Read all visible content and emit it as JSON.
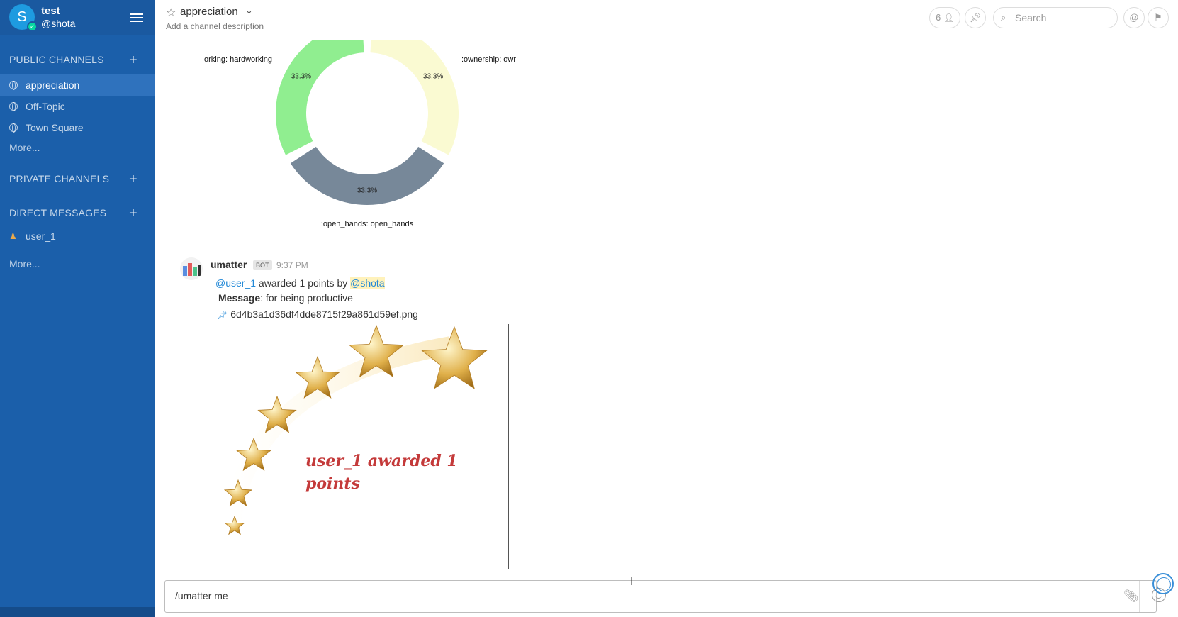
{
  "team": {
    "initial": "S",
    "name": "test",
    "username": "@shota"
  },
  "sidebar": {
    "public_title": "PUBLIC CHANNELS",
    "public_channels": [
      {
        "label": "appreciation",
        "active": true
      },
      {
        "label": "Off-Topic",
        "active": false
      },
      {
        "label": "Town Square",
        "active": false
      }
    ],
    "public_more": "More...",
    "private_title": "PRIVATE CHANNELS",
    "dm_title": "DIRECT MESSAGES",
    "direct_messages": [
      {
        "label": "user_1"
      }
    ],
    "dm_more": "More...",
    "add_symbol": "+"
  },
  "header": {
    "channel_name": "appreciation",
    "description": "Add a channel description",
    "member_count": "6",
    "search_placeholder": "Search",
    "mention_symbol": "@"
  },
  "chart_data": {
    "type": "pie",
    "categories": [
      ":hardworking: hardworking",
      ":ownership: owr",
      ":open_hands: open_hands"
    ],
    "visible_labels": [
      "orking: hardworking",
      ":ownership: owr",
      ":open_hands: open_hands"
    ],
    "values": [
      33.3,
      33.3,
      33.3
    ],
    "value_labels": [
      "33.3%",
      "33.3%",
      "33.3%"
    ],
    "colors": [
      "#90ee90",
      "#fafad2",
      "#778899"
    ]
  },
  "post": {
    "username": "umatter",
    "badge": "BOT",
    "time": "9:37 PM",
    "mention_user": "@user_1",
    "awarded_text": "awarded 1 points by",
    "mention_by": "@shota",
    "message_label": "Message",
    "message_text": ": for being productive",
    "file_name": "6d4b3a1d36df4dde8715f29a861d59ef.png",
    "image_text": "user_1 awarded 1 points"
  },
  "composer": {
    "value": "/umatter me"
  }
}
